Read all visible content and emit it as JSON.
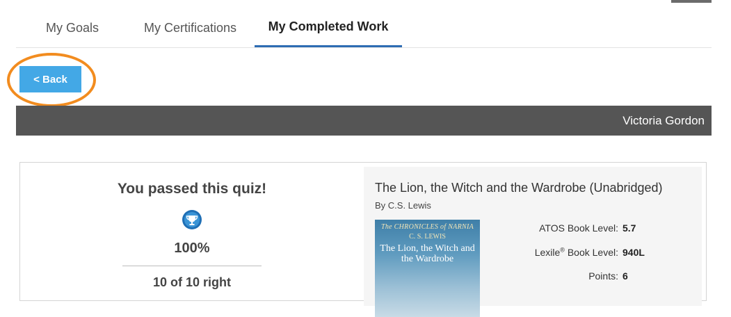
{
  "tabs": [
    {
      "label": "My Goals",
      "active": false
    },
    {
      "label": "My Certifications",
      "active": false
    },
    {
      "label": "My Completed Work",
      "active": true
    }
  ],
  "back_button": {
    "label": "< Back"
  },
  "user_bar": {
    "name": "Victoria Gordon"
  },
  "quiz_result": {
    "title": "You passed this quiz!",
    "icon": "trophy-icon",
    "score": "100%",
    "correct_count": "10 of 10 right"
  },
  "book": {
    "title": "The Lion, the Witch and the Wardrobe (Unabridged)",
    "author": "By C.S. Lewis",
    "cover": {
      "series": "The CHRONICLES of NARNIA",
      "author": "C. S. LEWIS",
      "title": "The Lion, the Witch and the Wardrobe"
    },
    "stats": {
      "atos_label": "ATOS Book Level:",
      "atos_value": "5.7",
      "lexile_label": "Lexile",
      "lexile_mark": "®",
      "lexile_label_suffix": " Book Level:",
      "lexile_value": "940L",
      "points_label": "Points:",
      "points_value": "6"
    }
  },
  "colors": {
    "active_tab_underline": "#2d6cb3",
    "back_button": "#43a8e6",
    "highlight_ring": "#f28c1f",
    "user_bar": "#555555"
  }
}
